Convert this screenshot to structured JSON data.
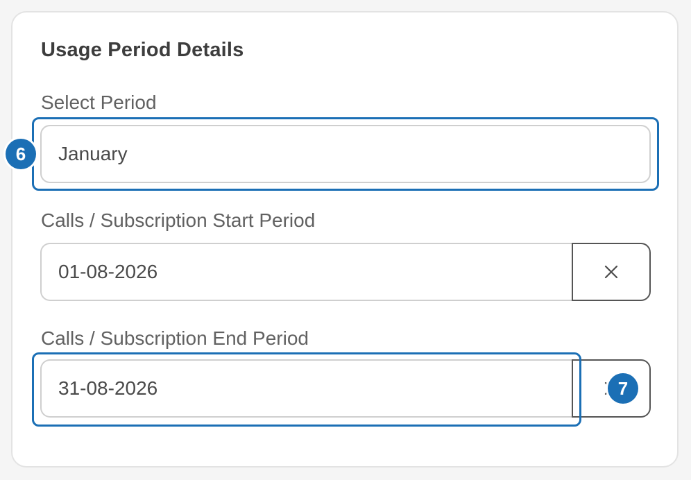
{
  "section": {
    "title": "Usage Period Details"
  },
  "select_period": {
    "label": "Select Period",
    "value": "January",
    "badge": "6"
  },
  "start_period": {
    "label": "Calls / Subscription Start Period",
    "value": "01-08-2026",
    "clear_icon": "close-icon"
  },
  "end_period": {
    "label": "Calls / Subscription End Period",
    "value": "31-08-2026",
    "clear_icon": "close-icon",
    "badge": "7"
  },
  "colors": {
    "accent": "#1b6fb5",
    "border": "#cfcfcf",
    "text": "#4a4a4a",
    "label": "#616161"
  }
}
